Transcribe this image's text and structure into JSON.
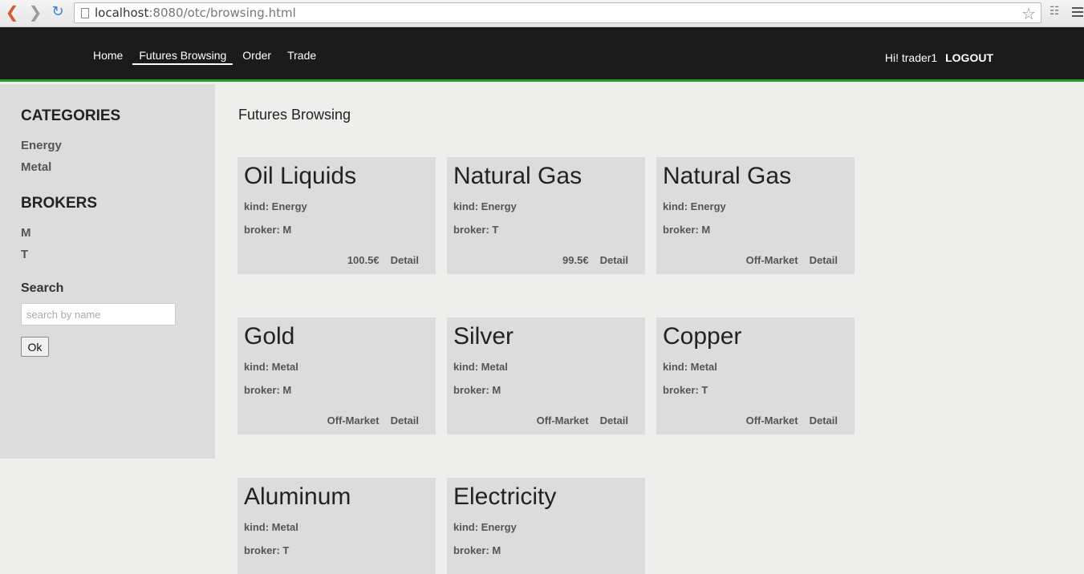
{
  "browser": {
    "url_host": "localhost",
    "url_rest": ":8080/otc/browsing.html"
  },
  "header": {
    "nav": [
      "Home",
      "Futures Browsing",
      "Order",
      "Trade"
    ],
    "greeting": "Hi! trader1",
    "logout": "LOGOUT"
  },
  "sidebar": {
    "categories_heading": "CATEGORIES",
    "categories": [
      "Energy",
      "Metal"
    ],
    "brokers_heading": "BROKERS",
    "brokers": [
      "M",
      "T"
    ],
    "search_label": "Search",
    "search_placeholder": "search by name",
    "ok_label": "Ok"
  },
  "main": {
    "title": "Futures Browsing",
    "cards": [
      {
        "title": "Oil Liquids",
        "kind": "kind: Energy",
        "broker": "broker: M",
        "status": "100.5€",
        "detail": "Detail"
      },
      {
        "title": "Natural Gas",
        "kind": "kind: Energy",
        "broker": "broker: T",
        "status": "99.5€",
        "detail": "Detail"
      },
      {
        "title": "Natural Gas",
        "kind": "kind: Energy",
        "broker": "broker: M",
        "status": "Off-Market",
        "detail": "Detail"
      },
      {
        "title": "Gold",
        "kind": "kind: Metal",
        "broker": "broker: M",
        "status": "Off-Market",
        "detail": "Detail"
      },
      {
        "title": "Silver",
        "kind": "kind: Metal",
        "broker": "broker: M",
        "status": "Off-Market",
        "detail": "Detail"
      },
      {
        "title": "Copper",
        "kind": "kind: Metal",
        "broker": "broker: T",
        "status": "Off-Market",
        "detail": "Detail"
      },
      {
        "title": "Aluminum",
        "kind": "kind: Metal",
        "broker": "broker: T",
        "status": "",
        "detail": ""
      },
      {
        "title": "Electricity",
        "kind": "kind: Energy",
        "broker": "broker: M",
        "status": "",
        "detail": ""
      }
    ]
  }
}
